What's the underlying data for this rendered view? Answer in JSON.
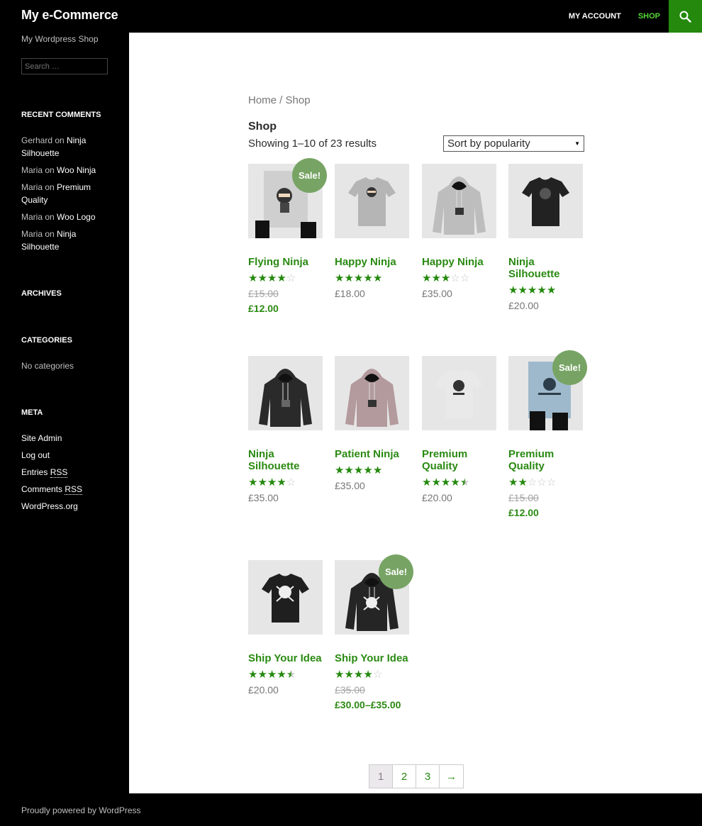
{
  "header": {
    "site_title": "My e-Commerce",
    "nav": [
      "MY ACCOUNT",
      "SHOP"
    ],
    "active_nav": "SHOP",
    "search_icon": "search-icon"
  },
  "sidebar": {
    "tagline": "My Wordpress Shop",
    "search_placeholder": "Search …",
    "recent_comments_title": "RECENT COMMENTS",
    "recent_comments": [
      {
        "author": "Gerhard",
        "on": "on",
        "post": "Ninja Silhouette"
      },
      {
        "author": "Maria",
        "on": "on",
        "post": "Woo Ninja"
      },
      {
        "author": "Maria",
        "on": "on",
        "post": "Premium Quality"
      },
      {
        "author": "Maria",
        "on": "on",
        "post": "Woo Logo"
      },
      {
        "author": "Maria",
        "on": "on",
        "post": "Ninja Silhouette"
      }
    ],
    "archives_title": "ARCHIVES",
    "categories_title": "CATEGORIES",
    "categories_empty": "No categories",
    "meta_title": "META",
    "meta_links": [
      "Site Admin",
      "Log out",
      "Entries",
      "Comments",
      "WordPress.org"
    ],
    "rss": "RSS"
  },
  "main": {
    "breadcrumb": "Home / Shop",
    "page_title": "Shop",
    "result_count": "Showing 1–10 of 23 results",
    "sort_selected": "Sort by popularity",
    "sale_label": "Sale!",
    "products": [
      {
        "name": "Flying Ninja",
        "rating": 4,
        "old_price": "£15.00",
        "price": "£12.00",
        "on_sale": true,
        "kind": "poster-ninja"
      },
      {
        "name": "Happy Ninja",
        "rating": 5,
        "price": "£18.00",
        "on_sale": false,
        "kind": "tshirt-grey"
      },
      {
        "name": "Happy Ninja",
        "rating": 3,
        "price": "£35.00",
        "on_sale": false,
        "kind": "hoodie-grey"
      },
      {
        "name": "Ninja Silhouette",
        "rating": 5,
        "price": "£20.00",
        "on_sale": false,
        "kind": "tshirt-black"
      },
      {
        "name": "Ninja Silhouette",
        "rating": 4,
        "price": "£35.00",
        "on_sale": false,
        "kind": "hoodie-black"
      },
      {
        "name": "Patient Ninja",
        "rating": 5,
        "price": "£35.00",
        "on_sale": false,
        "kind": "hoodie-pink"
      },
      {
        "name": "Premium Quality",
        "rating": 4.5,
        "price": "£20.00",
        "on_sale": false,
        "kind": "tshirt-white"
      },
      {
        "name": "Premium Quality",
        "rating": 2,
        "old_price": "£15.00",
        "price": "£12.00",
        "on_sale": true,
        "kind": "poster-woo"
      },
      {
        "name": "Ship Your Idea",
        "rating": 4.5,
        "price": "£20.00",
        "on_sale": false,
        "kind": "tshirt-skull"
      },
      {
        "name": "Ship Your Idea",
        "rating": 4,
        "old_price": "£35.00",
        "price": "£30.00–£35.00",
        "on_sale": true,
        "kind": "hoodie-skull"
      }
    ],
    "pagination": [
      "1",
      "2",
      "3",
      "→"
    ],
    "current_page": "1"
  },
  "footer": {
    "text": "Proudly powered by WordPress"
  },
  "colors": {
    "accent": "#24890d",
    "link": "#2a8a12",
    "sale_badge": "#77a464",
    "nav_active": "#55d737"
  }
}
